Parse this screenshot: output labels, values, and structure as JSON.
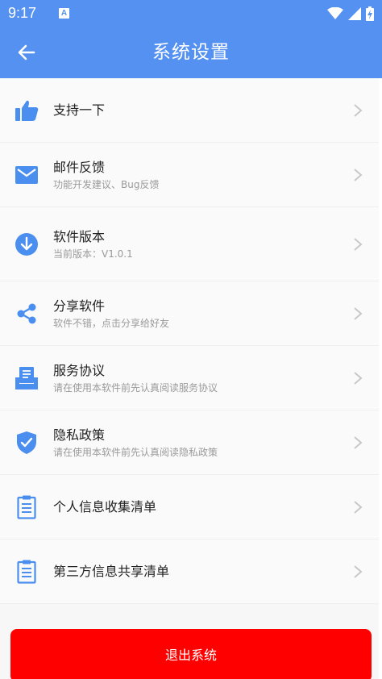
{
  "status_bar": {
    "time": "9:17",
    "notification_badge": "A",
    "icons": [
      "wifi-icon",
      "signal-icon",
      "battery-charging-icon"
    ]
  },
  "app_bar": {
    "title": "系统设置",
    "back_icon": "arrow-left-icon"
  },
  "colors": {
    "primary": "#5591f0",
    "logout": "#ff0000",
    "chevron": "#c8c8c8"
  },
  "settings": [
    {
      "label": "支持一下",
      "sub": "",
      "icon": "thumbs-up-icon"
    },
    {
      "label": "邮件反馈",
      "sub": "功能开发建议、Bug反馈",
      "icon": "mail-icon"
    },
    {
      "label": "软件版本",
      "sub": "当前版本：V1.0.1",
      "icon": "download-circle-icon"
    },
    {
      "label": "分享软件",
      "sub": "软件不错，点击分享给好友",
      "icon": "share-icon"
    },
    {
      "label": "服务协议",
      "sub": "请在使用本软件前先认真阅读服务协议",
      "icon": "document-tray-icon"
    },
    {
      "label": "隐私政策",
      "sub": "请在使用本软件前先认真阅读隐私政策",
      "icon": "shield-check-icon"
    },
    {
      "label": "个人信息收集清单",
      "sub": "",
      "icon": "clipboard-list-icon"
    },
    {
      "label": "第三方信息共享清单",
      "sub": "",
      "icon": "clipboard-list-icon"
    }
  ],
  "logout_button": "退出系统"
}
